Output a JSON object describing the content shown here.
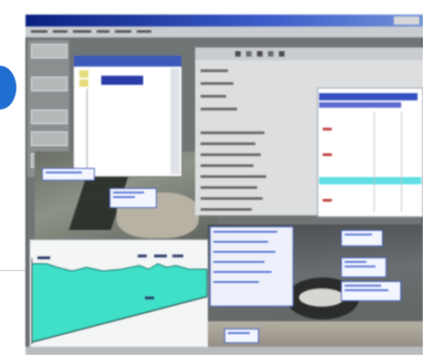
{
  "window": {
    "title": "",
    "menu": [],
    "toolbar": []
  },
  "dialog": {
    "title": "",
    "selected_item": ""
  },
  "property_panel": {
    "rows": [],
    "highlight_row": ""
  },
  "map_labels": [],
  "chart_labels": [],
  "status_text": "",
  "colors": {
    "titlebar": "#1e3c9c",
    "accent_blue": "#1f6fd1",
    "profile_fill": "#3fe0c8",
    "highlight_row": "#5fe0e6",
    "selection": "#2a3aa8"
  }
}
